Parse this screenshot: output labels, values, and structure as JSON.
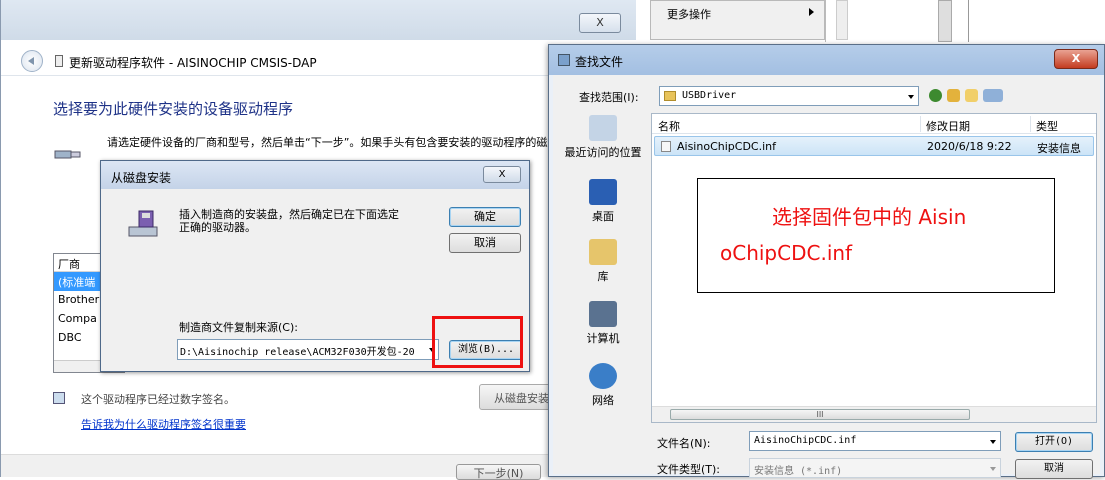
{
  "background_menu": {
    "item": "更多操作"
  },
  "main_window": {
    "title_cut": "　　　　",
    "close_label": "X",
    "title": "更新驱动程序软件 - AISINOCHIP CMSIS-DAP",
    "heading": "选择要为此硬件安装的设备驱动程序",
    "instruction": "请选定硬件设备的厂商和型号，然后单击“下一步”。如果手头有包含要安装的驱动程序的磁盘，请单击“从磁盘安装”。",
    "manufacturer_header": "厂商",
    "manufacturers": [
      "(标准端",
      "Brother",
      "Compa",
      "DBC"
    ],
    "signed_text": "这个驱动程序已经过数字签名。",
    "signing_link": "告诉我为什么驱动程序签名很重要",
    "from_disk_button": "从磁盘安装",
    "next_button": "下一步(N)"
  },
  "install_disk_dialog": {
    "title": "从磁盘安装",
    "close_label": "X",
    "message": "插入制造商的安装盘，然后确定已在下面选定正确的驱动器。",
    "ok_button": "确定",
    "cancel_button": "取消",
    "source_label": "制造商文件复制来源(C):",
    "source_path": "D:\\Aisinochip release\\ACM32F030开发包-20",
    "browse_button": "浏览(B)..."
  },
  "find_file_dialog": {
    "title": "查找文件",
    "close_label": "X",
    "look_in_label": "查找范围(I):",
    "look_in_value": "USBDriver",
    "places": [
      {
        "label": "最近访问的位置",
        "icon": "recent-places-icon"
      },
      {
        "label": "桌面",
        "icon": "desktop-icon"
      },
      {
        "label": "库",
        "icon": "libraries-icon"
      },
      {
        "label": "计算机",
        "icon": "computer-icon"
      },
      {
        "label": "网络",
        "icon": "network-icon"
      }
    ],
    "columns": {
      "name": "名称",
      "modified": "修改日期",
      "type": "类型"
    },
    "files": [
      {
        "name": "AisinoChipCDC.inf",
        "modified": "2020/6/18 9:22",
        "type": "安装信息"
      }
    ],
    "scroll_thumb": "III",
    "filename_label": "文件名(N):",
    "filename_value": "AisinoChipCDC.inf",
    "filetype_label": "文件类型(T):",
    "filetype_value": "安装信息 (*.inf)",
    "open_button": "打开(O)",
    "cancel_button": "取消"
  },
  "annotation": {
    "line1": "选择固件包中的 Aisin",
    "line2": "oChipCDC.inf",
    "color": "#ee1111"
  },
  "highlight_color": "#ee1111"
}
